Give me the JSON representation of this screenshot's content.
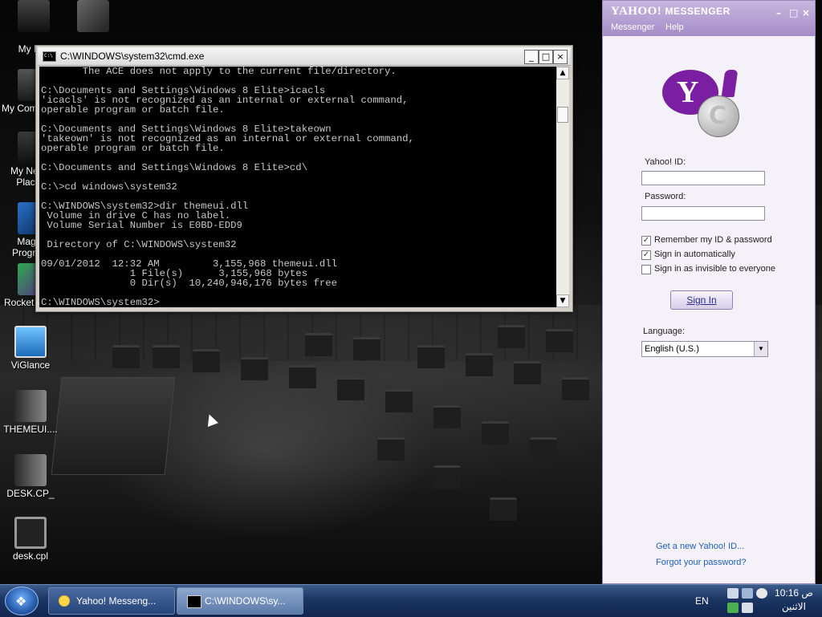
{
  "desktop": {
    "icons": [
      {
        "label": "My Docum"
      },
      {
        "label": "My Com"
      },
      {
        "label": "My Net Plac"
      },
      {
        "label": "Mag Progra"
      },
      {
        "label": "Rocket"
      },
      {
        "label": "ViGlance"
      },
      {
        "label": "THEMEUI...."
      },
      {
        "label": "DESK.CP_"
      },
      {
        "label": "desk.cpl"
      }
    ]
  },
  "cmd": {
    "title": "C:\\WINDOWS\\system32\\cmd.exe",
    "minimize": "_",
    "maximize": "□",
    "close": "×",
    "output": "       The ACE does not apply to the current file/directory.\n\nC:\\Documents and Settings\\Windows 8 Elite>icacls\n'icacls' is not recognized as an internal or external command,\noperable program or batch file.\n\nC:\\Documents and Settings\\Windows 8 Elite>takeown\n'takeown' is not recognized as an internal or external command,\noperable program or batch file.\n\nC:\\Documents and Settings\\Windows 8 Elite>cd\\\n\nC:\\>cd windows\\system32\n\nC:\\WINDOWS\\system32>dir themeui.dll\n Volume in drive C has no label.\n Volume Serial Number is E0BD-EDD9\n\n Directory of C:\\WINDOWS\\system32\n\n09/01/2012  12:32 AM         3,155,968 themeui.dll\n               1 File(s)      3,155,968 bytes\n               0 Dir(s)  10,240,946,176 bytes free\n\nC:\\WINDOWS\\system32>"
  },
  "messenger": {
    "brand": "YAHOO!",
    "brand_sub": "MESSENGER",
    "menu": [
      "Messenger",
      "Help"
    ],
    "logo_letter": "Y",
    "yahoo_id_label": "Yahoo! ID:",
    "yahoo_id_value": "",
    "password_label": "Password:",
    "password_value": "",
    "remember_label": "Remember my ID & password",
    "remember_checked": true,
    "auto_label": "Sign in automatically",
    "auto_checked": true,
    "invisible_label": "Sign in as invisible to everyone",
    "invisible_checked": false,
    "sign_in_label": "Sign In",
    "language_label": "Language:",
    "language_value": "English (U.S.)",
    "new_id_link": "Get a new Yahoo! ID...",
    "forgot_link": "Forgot your password?"
  },
  "taskbar": {
    "buttons": [
      {
        "label": "Yahoo! Messeng..."
      },
      {
        "label": "C:\\WINDOWS\\sy..."
      }
    ],
    "lang": "EN",
    "time": "10:16 ص",
    "day": "الاثنين"
  },
  "colors": {
    "yahoo_purple": "#7b1fa2",
    "taskbar": "#1c3563",
    "console_bg": "#000000",
    "console_text": "#c8c8c8"
  }
}
